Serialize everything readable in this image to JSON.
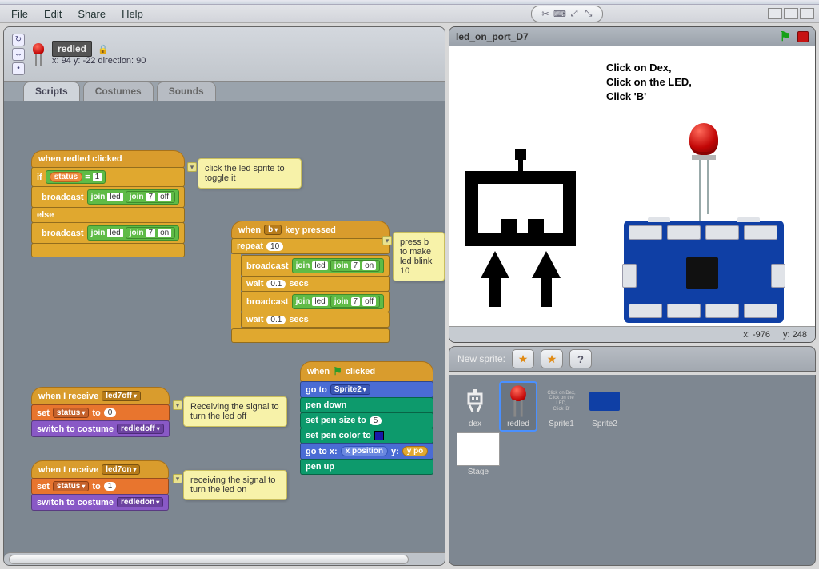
{
  "menubar": {
    "file": "File",
    "edit": "Edit",
    "share": "Share",
    "help": "Help"
  },
  "sprite_header": {
    "name": "redled",
    "coords": "x: 94   y: -22   direction: 90"
  },
  "tabs": {
    "scripts": "Scripts",
    "costumes": "Costumes",
    "sounds": "Sounds"
  },
  "comment1": "click the led sprite to toggle it",
  "comment2": "press b to make led blink 10",
  "comment3": "Receiving the signal to turn the led off",
  "comment4": "receiving the signal to turn the led on",
  "blocks": {
    "when_redled": "when redled clicked",
    "if": "if",
    "status": "status",
    "eq": "=",
    "one": "1",
    "broadcast": "broadcast",
    "join": "join",
    "led": "led",
    "seven": "7",
    "off": "off",
    "on": "on",
    "else": "else",
    "when_key": "when",
    "key_b": "b",
    "key_pressed": "key pressed",
    "repeat": "repeat",
    "ten": "10",
    "wait": "wait",
    "pt1": "0.1",
    "secs": "secs",
    "when_receive": "when I receive",
    "led7off": "led7off",
    "led7on": "led7on",
    "set": "set",
    "to": "to",
    "zero": "0",
    "switch_costume": "switch to costume",
    "redledoff": "redledoff",
    "redledon": "redledon",
    "when_flag": "when",
    "clicked": "clicked",
    "goto": "go to",
    "sprite2": "Sprite2",
    "pendown": "pen down",
    "penup": "pen up",
    "pensize": "set pen size to",
    "five": "5",
    "pencolor": "set pen color to",
    "gotoxy": "go to x:",
    "y": "y:",
    "xpos": "x position",
    "ypos": "y po"
  },
  "stage": {
    "title": "led_on_port_D7",
    "instr1": "Click on Dex,",
    "instr2": "Click on the LED,",
    "instr3": "Click 'B'",
    "mx": "x: -976",
    "my": "y: 248"
  },
  "spritebar": {
    "label": "New sprite:",
    "dex": "dex",
    "redled": "redled",
    "s1": "Sprite1",
    "s2": "Sprite2",
    "stage": "Stage"
  }
}
